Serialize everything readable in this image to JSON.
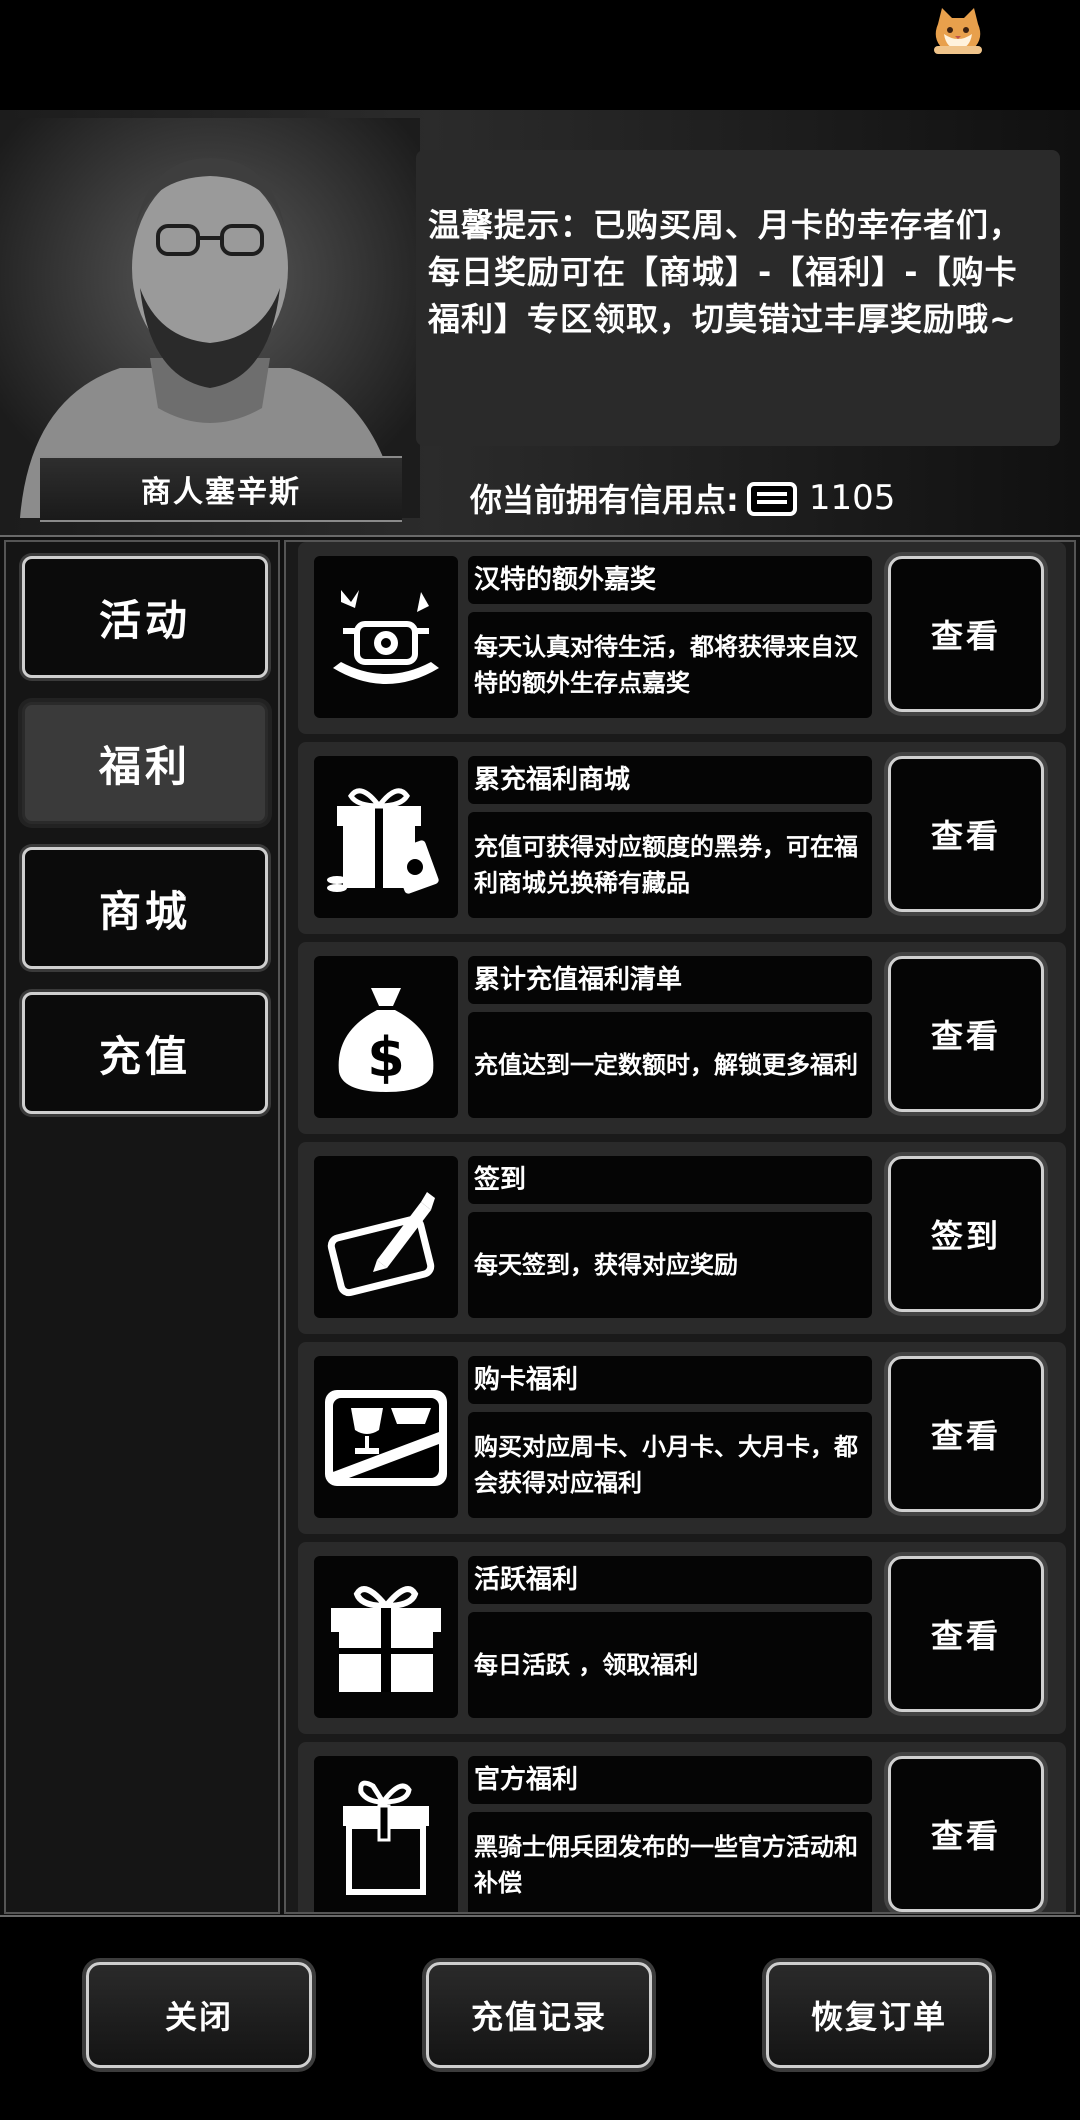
{
  "tip": {
    "text": "温馨提示：已购买周、月卡的幸存者们，每日奖励可在【商城】-【福利】-【购卡福利】专区领取，切莫错过丰厚奖励哦~"
  },
  "merchant": {
    "name": "商人塞辛斯"
  },
  "credits": {
    "label": "你当前拥有信用点:",
    "value": "1105"
  },
  "sidebar": {
    "items": [
      {
        "label": "活动",
        "active": false
      },
      {
        "label": "福利",
        "active": true
      },
      {
        "label": "商城",
        "active": false
      },
      {
        "label": "充值",
        "active": false
      }
    ]
  },
  "items": [
    {
      "icon": "reward-drone-icon",
      "title": "汉特的额外嘉奖",
      "desc": "每天认真对待生活，都将获得来自汉特的额外生存点嘉奖",
      "button": "查看"
    },
    {
      "icon": "gift-coupon-icon",
      "title": "累充福利商城",
      "desc": "充值可获得对应额度的黑券，可在福利商城兑换稀有藏品",
      "button": "查看"
    },
    {
      "icon": "money-bag-icon",
      "title": "累计充值福利清单",
      "desc": "充值达到一定数额时，解锁更多福利",
      "button": "查看"
    },
    {
      "icon": "tablet-pen-icon",
      "title": "签到",
      "desc": "每天签到，获得对应奖励",
      "button": "签到"
    },
    {
      "icon": "trophy-card-icon",
      "title": "购卡福利",
      "desc": "购买对应周卡、小月卡、大月卡，都会获得对应福利",
      "button": "查看"
    },
    {
      "icon": "gift-box-icon",
      "title": "活跃福利",
      "desc": "每日活跃 ，领取福利",
      "button": "查看"
    },
    {
      "icon": "open-box-icon",
      "title": "官方福利",
      "desc": "黑骑士佣兵团发布的一些官方活动和补偿",
      "button": "查看"
    }
  ],
  "bottom": {
    "close_label": "关闭",
    "recharge_record_label": "充值记录",
    "restore_order_label": "恢复订单"
  }
}
